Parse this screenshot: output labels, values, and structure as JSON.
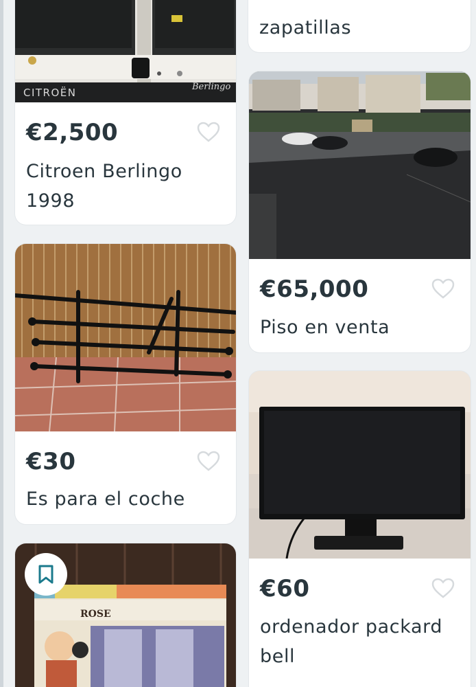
{
  "listings": [
    {
      "id": "citroen",
      "price": "€2,500",
      "title": "Citroen Berlingo 1998",
      "image": "white-citroen-berlingo-van",
      "brand_text": "CITROËN",
      "model_text": "Berlingo"
    },
    {
      "id": "zapatillas",
      "price": "",
      "title": "zapatillas",
      "image": ""
    },
    {
      "id": "piso",
      "price": "€65,000",
      "title": "Piso en venta",
      "image": "parking-lot-view"
    },
    {
      "id": "rack",
      "price": "€30",
      "title": "Es para el coche",
      "image": "car-bike-rack"
    },
    {
      "id": "monitor",
      "price": "€60",
      "title": "ordenador packard bell",
      "image": "black-monitor"
    },
    {
      "id": "boardgame",
      "price": "",
      "title": "",
      "image": "board-game-card",
      "card_text": "ROSE"
    }
  ],
  "icons": {
    "favorite": "heart-outline-icon",
    "saved": "bookmark-icon"
  },
  "colors": {
    "accent": "#1b7a8c",
    "text": "#29363d",
    "heart": "#d9dde0"
  }
}
